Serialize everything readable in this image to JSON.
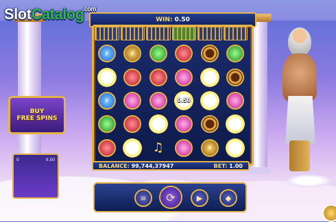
{
  "logo": {
    "text_a": "Slot",
    "text_b": "Catalog",
    "domain": ".com"
  },
  "win": {
    "label": "WIN:",
    "value": "0.50"
  },
  "balance": {
    "label": "BALANCE:",
    "value": "99,744,37947"
  },
  "bet": {
    "label": "BET:",
    "value": "1.00"
  },
  "buy": {
    "line1": "BUY",
    "line2": "FREE SPINS"
  },
  "mini_panel": {
    "count": "0",
    "amount": "0.50"
  },
  "cages": [
    "blue-lock",
    "gold",
    "gold",
    "green",
    "pink",
    "gold"
  ],
  "reels": [
    [
      "blue",
      "orb",
      "blue",
      "green",
      "red"
    ],
    [
      "light",
      "red",
      "pink",
      "red",
      "orb"
    ],
    [
      "green",
      "red",
      "pink",
      "orb",
      "harp"
    ],
    [
      "red",
      "pink",
      "orb",
      "pink",
      "pink"
    ],
    [
      "ring",
      "orb",
      "orb",
      "ring",
      "light"
    ],
    [
      "green",
      "ring",
      "pink",
      "orb",
      "orb"
    ]
  ],
  "highlight_value": "0.50",
  "colors": {
    "frame": "#e6b34a",
    "accent": "#f8d978",
    "panel": "#13225e"
  },
  "controls": [
    "settings-icon",
    "autoplay-icon",
    "spin-icon",
    "turbo-icon",
    "bet-icon"
  ]
}
